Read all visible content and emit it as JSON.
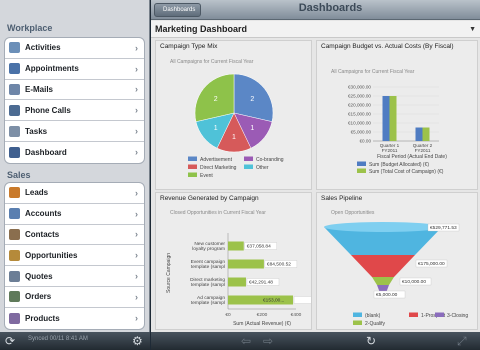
{
  "sidebar": {
    "workplace_header": "Workplace",
    "sales_header": "Sales",
    "workplace_items": [
      {
        "label": "Activities",
        "icon": "activities-icon",
        "color": "#6b8fb8"
      },
      {
        "label": "Appointments",
        "icon": "calendar-icon",
        "color": "#4a72a8"
      },
      {
        "label": "E-Mails",
        "icon": "email-icon",
        "color": "#6e86a8"
      },
      {
        "label": "Phone Calls",
        "icon": "phone-icon",
        "color": "#4c6b92"
      },
      {
        "label": "Tasks",
        "icon": "task-icon",
        "color": "#7d8fa6"
      },
      {
        "label": "Dashboard",
        "icon": "dashboard-icon",
        "color": "#3f5f8f"
      }
    ],
    "sales_items": [
      {
        "label": "Leads",
        "icon": "lead-icon",
        "color": "#c97a2b"
      },
      {
        "label": "Accounts",
        "icon": "account-icon",
        "color": "#5a7fb0"
      },
      {
        "label": "Contacts",
        "icon": "contact-icon",
        "color": "#8a6e4e"
      },
      {
        "label": "Opportunities",
        "icon": "opportunity-icon",
        "color": "#b58a3a"
      },
      {
        "label": "Quotes",
        "icon": "quote-icon",
        "color": "#6c7e96"
      },
      {
        "label": "Orders",
        "icon": "order-icon",
        "color": "#5f7a5a"
      },
      {
        "label": "Products",
        "icon": "product-icon",
        "color": "#7f6aa0"
      }
    ],
    "synced_text": "Synced 00/11 8:41 AM"
  },
  "navbar": {
    "back_label": "Dashboards",
    "title": "Dashboards"
  },
  "dashboard": {
    "title": "Marketing Dashboard"
  },
  "panels": {
    "campaign_type_mix": {
      "title": "Campaign Type Mix",
      "subtitle": "All Campaigns for Current Fiscal Year"
    },
    "budget_vs_actual": {
      "title": "Campaign Budget vs. Actual Costs (By Fiscal)",
      "subtitle": "All Campaigns for Current Fiscal Year"
    },
    "revenue_by_campaign": {
      "title": "Revenue Generated by Campaign",
      "subtitle": "Closed Opportunities in Current Fiscal Year"
    },
    "sales_pipeline": {
      "title": "Sales Pipeline",
      "subtitle": "Open Opportunities"
    }
  },
  "chart_data": [
    {
      "type": "pie",
      "title": "Campaign Type Mix",
      "categories": [
        "Advertisement",
        "Co-branding",
        "Direct Marketing",
        "Other",
        "Event"
      ],
      "values": [
        2,
        1,
        1,
        1,
        2
      ],
      "data_labels": [
        "2",
        "1",
        "1",
        "1",
        "2"
      ],
      "colors": [
        "#5b87c6",
        "#9b5bb5",
        "#d65a5a",
        "#4fc2d8",
        "#8ec24a"
      ],
      "legend": "bottom"
    },
    {
      "type": "bar",
      "title": "Campaign Budget vs. Actual Costs (By Fiscal)",
      "categories": [
        "Quarter 1 FY2011",
        "Quarter 2 FY2011"
      ],
      "series": [
        {
          "name": "Sum (Budget Allocated) (€)",
          "values": [
            25000,
            7500
          ],
          "color": "#4f7cc2"
        },
        {
          "name": "Sum (Total Cost of Campaign) (€)",
          "values": [
            25000,
            7500
          ],
          "color": "#9cc24a"
        }
      ],
      "xlabel": "Fiscal Period (Actual End Date)",
      "ylim": [
        0,
        30000
      ],
      "y_ticks": [
        "€30,000.00",
        "€25,000.00",
        "€20,000.00",
        "€15,000.00",
        "€10,000.00",
        "€5,000.00",
        "€0.00"
      ],
      "legend": "bottom"
    },
    {
      "type": "bar",
      "orientation": "horizontal",
      "title": "Revenue Generated by Campaign",
      "categories": [
        "New customer loyalty program",
        "Event campaign template (sampl",
        "Direct marketing template (sampl",
        "Ad campaign template (sampl"
      ],
      "values": [
        37058.84,
        84500.52,
        42291.48,
        153000
      ],
      "data_labels": [
        "€37,058.84",
        "€84,500.52",
        "€42,291.48",
        "€153,00..."
      ],
      "xlabel": "Sum (Actual Revenue) (€)",
      "ylabel": "Source Campaign",
      "x_ticks": [
        "€0",
        "€200",
        "€400"
      ],
      "color": "#9cc24a"
    },
    {
      "type": "funnel",
      "title": "Sales Pipeline",
      "categories": [
        "(blank)",
        "1-Prospect",
        "2-Qualify",
        "3-Closing"
      ],
      "values": [
        529771.53,
        175000,
        10000,
        5000
      ],
      "data_labels": [
        "€529,771.53",
        "€175,000.00",
        "€10,000.00",
        "€5,000.00"
      ],
      "colors": [
        "#4fb5e0",
        "#e0484a",
        "#9cc24a",
        "#8a6cbc"
      ],
      "legend": "bottom"
    }
  ]
}
